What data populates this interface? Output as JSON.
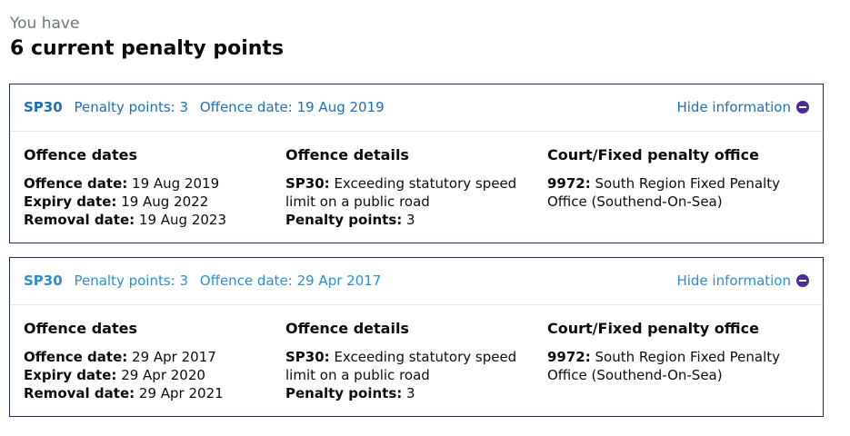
{
  "intro": {
    "caption": "You have",
    "heading": "6 current penalty points"
  },
  "columns": {
    "dates_heading": "Offence dates",
    "details_heading": "Offence details",
    "court_heading": "Court/Fixed penalty office"
  },
  "labels": {
    "offence_date": "Offence date:",
    "expiry_date": "Expiry date:",
    "removal_date": "Removal date:",
    "penalty_points": "Penalty points:"
  },
  "records": [
    {
      "code": "SP30",
      "summary_points": "Penalty points: 3",
      "summary_date": "Offence date: 19 Aug 2019",
      "toggle_label": "Hide information",
      "offence_date": "19 Aug 2019",
      "expiry_date": "19 Aug 2022",
      "removal_date": "19 Aug 2023",
      "detail_code": "SP30:",
      "detail_text": "Exceeding statutory speed limit on a public road",
      "penalty_points": "3",
      "office_code": "9972:",
      "office_name": "South Region Fixed Penalty Office (Southend-On-Sea)"
    },
    {
      "code": "SP30",
      "summary_points": "Penalty points: 3",
      "summary_date": "Offence date: 29 Apr 2017",
      "toggle_label": "Hide information",
      "offence_date": "29 Apr 2017",
      "expiry_date": "29 Apr 2020",
      "removal_date": "29 Apr 2021",
      "detail_code": "SP30:",
      "detail_text": "Exceeding statutory speed limit on a public road",
      "penalty_points": "3",
      "office_code": "9972:",
      "office_name": "South Region Fixed Penalty Office (Southend-On-Sea)"
    }
  ],
  "colors": {
    "link": "#1d70b8",
    "link_light": "#2a8ed3",
    "border": "#1d2b5c",
    "toggle_icon": "#4c2c92",
    "caption": "#6f777b"
  },
  "icons": {
    "toggle": "minus-circle-icon"
  }
}
